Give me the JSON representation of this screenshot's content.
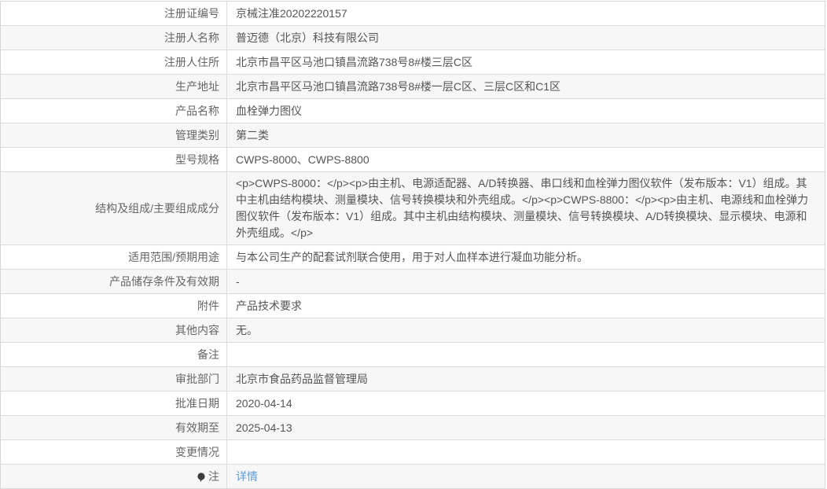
{
  "table": {
    "rows": [
      {
        "label": "注册证编号",
        "value": "京械注准20202220157"
      },
      {
        "label": "注册人名称",
        "value": "普迈德（北京）科技有限公司"
      },
      {
        "label": "注册人住所",
        "value": "北京市昌平区马池口镇昌流路738号8#楼三层C区"
      },
      {
        "label": "生产地址",
        "value": "北京市昌平区马池口镇昌流路738号8#楼一层C区、三层C区和C1区"
      },
      {
        "label": "产品名称",
        "value": "血栓弹力图仪"
      },
      {
        "label": "管理类别",
        "value": "第二类"
      },
      {
        "label": "型号规格",
        "value": "CWPS-8000、CWPS-8800"
      },
      {
        "label": "结构及组成/主要组成成分",
        "value": "<p>CWPS-8000：</p><p>由主机、电源适配器、A/D转换器、串口线和血栓弹力图仪软件（发布版本：V1）组成。其中主机由结构模块、测量模块、信号转换模块和外壳组成。</p><p>CWPS-8800：</p><p>由主机、电源线和血栓弹力图仪软件（发布版本：V1）组成。其中主机由结构模块、测量模块、信号转换模块、A/D转换模块、显示模块、电源和外壳组成。</p>"
      },
      {
        "label": "适用范围/预期用途",
        "value": "与本公司生产的配套试剂联合使用，用于对人血样本进行凝血功能分析。"
      },
      {
        "label": "产品储存条件及有效期",
        "value": "-"
      },
      {
        "label": "附件",
        "value": "产品技术要求"
      },
      {
        "label": "其他内容",
        "value": "无。"
      },
      {
        "label": "备注",
        "value": ""
      },
      {
        "label": "审批部门",
        "value": "北京市食品药品监督管理局"
      },
      {
        "label": "批准日期",
        "value": "2020-04-14"
      },
      {
        "label": "有效期至",
        "value": "2025-04-13"
      },
      {
        "label": "变更情况",
        "value": ""
      },
      {
        "label": "注",
        "value": "详情",
        "link": true,
        "icon": "note-icon"
      }
    ],
    "colors": {
      "link": "#5a9cd9",
      "row_alt_bg": "#f7f7f7",
      "border": "#dcdcdc",
      "label_text": "#666666",
      "value_text": "#555555"
    }
  }
}
